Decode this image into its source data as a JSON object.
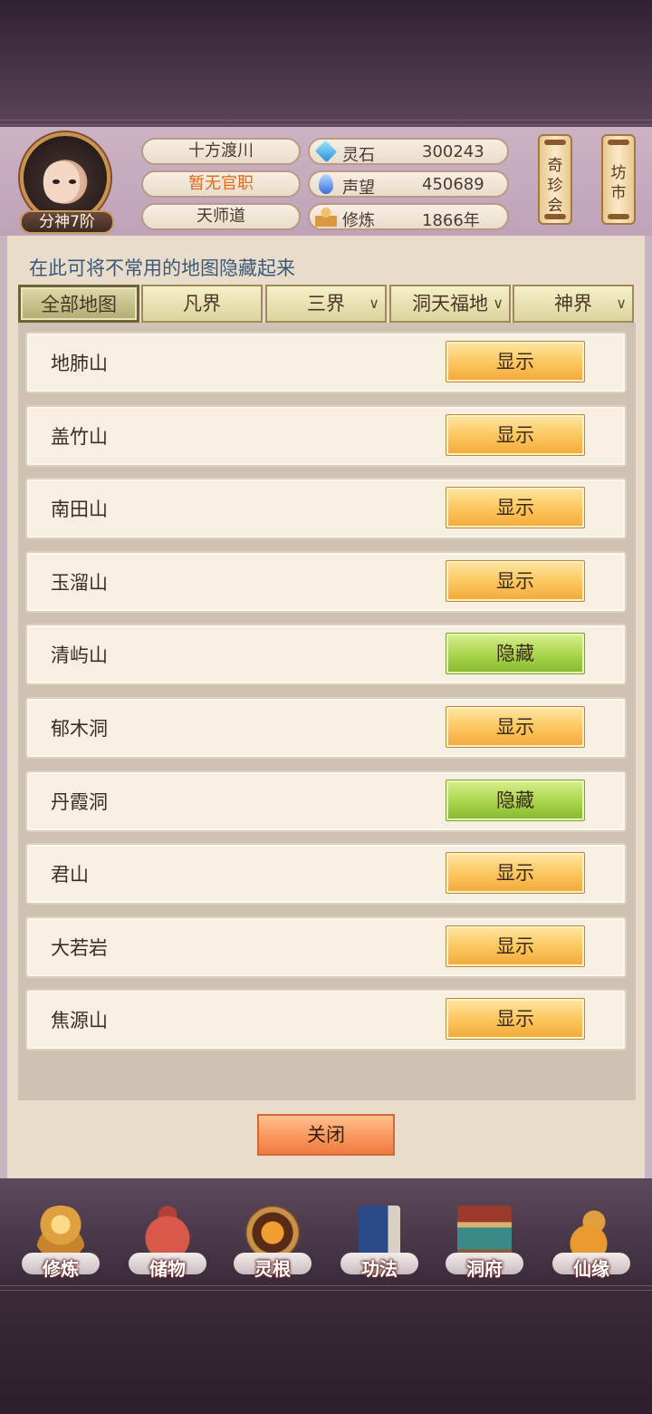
{
  "header": {
    "rank_badge": "分神7阶",
    "location": "十方渡川",
    "official_title": "暂无官职",
    "sect": "天师道",
    "stats": [
      {
        "label": "灵石",
        "value": "300243",
        "icon": "spirit-stone-icon"
      },
      {
        "label": "声望",
        "value": "450689",
        "icon": "reputation-icon"
      },
      {
        "label": "修炼",
        "value": "1866年",
        "icon": "cultivation-icon"
      }
    ],
    "scroll_buttons": [
      "奇珍会",
      "坊市"
    ]
  },
  "panel": {
    "hint": "在此可将不常用的地图隐藏起来",
    "tabs": [
      "全部地图",
      "凡界",
      "三界",
      "洞天福地",
      "神界"
    ],
    "rows": [
      {
        "name": "地肺山",
        "action": "显示"
      },
      {
        "name": "盖竹山",
        "action": "显示"
      },
      {
        "name": "南田山",
        "action": "显示"
      },
      {
        "name": "玉溜山",
        "action": "显示"
      },
      {
        "name": "清屿山",
        "action": "隐藏"
      },
      {
        "name": "郁木洞",
        "action": "显示"
      },
      {
        "name": "丹霞洞",
        "action": "隐藏"
      },
      {
        "name": "君山",
        "action": "显示"
      },
      {
        "name": "大若岩",
        "action": "显示"
      },
      {
        "name": "焦源山",
        "action": "显示"
      }
    ],
    "close_label": "关闭"
  },
  "nav": [
    {
      "label": "修炼",
      "icon": "meditation-icon"
    },
    {
      "label": "储物",
      "icon": "storage-bag-icon"
    },
    {
      "label": "灵根",
      "icon": "spirit-root-icon"
    },
    {
      "label": "功法",
      "icon": "technique-book-icon"
    },
    {
      "label": "洞府",
      "icon": "cave-dwelling-icon"
    },
    {
      "label": "仙缘",
      "icon": "gourd-icon"
    }
  ],
  "colors": {
    "show_button": "#fcc860",
    "hide_button": "#a8d44a",
    "close_button": "#f8945a",
    "hint_text": "#3b5a78",
    "official_title": "#e06a1c"
  }
}
